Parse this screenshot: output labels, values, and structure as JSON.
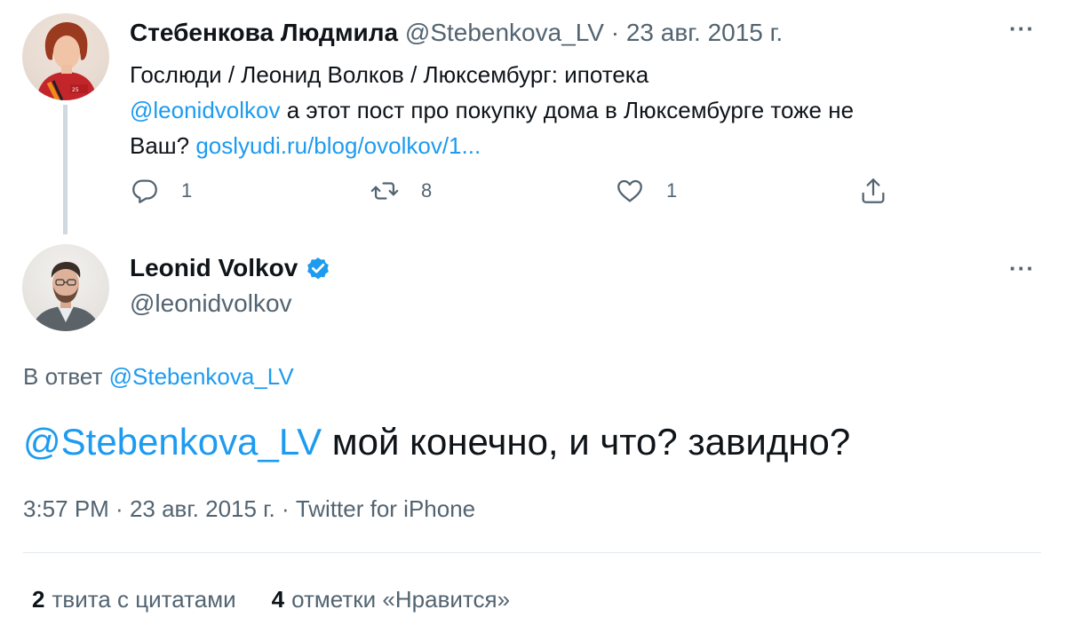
{
  "parent_tweet": {
    "author_name": "Стебенкова Людмила",
    "author_handle": "@Stebenkova_LV",
    "separator": "·",
    "date": "23 авг. 2015 г.",
    "more_label": "···",
    "line1": "Гослюди / Леонид Волков / Люксембург: ипотека",
    "mention": "@leonidvolkov",
    "line2_text": " а этот пост про покупку дома в Люксембурге тоже не",
    "line3_text": "Ваш? ",
    "url": "goslyudi.ru/blog/ovolkov/1...",
    "reply_count": "1",
    "retweet_count": "8",
    "like_count": "1"
  },
  "main_tweet": {
    "author_name": "Leonid Volkov",
    "author_handle": "@leonidvolkov",
    "more_label": "···",
    "reply_prefix": "В ответ ",
    "reply_to": "@Stebenkova_LV",
    "text_mention": "@Stebenkova_LV",
    "text": " мой конечно, и что? завидно?",
    "time": "3:57 PM",
    "meta_sep1": " · ",
    "date": "23 авг. 2015 г.",
    "meta_sep2": " · ",
    "source": "Twitter for iPhone",
    "quote_count": "2",
    "quote_label": "твита с цитатами",
    "like_count": "4",
    "like_label": "отметки «Нравится»"
  },
  "icons": {
    "reply": "reply-icon",
    "retweet": "retweet-icon",
    "like": "heart-icon",
    "share": "share-icon",
    "verified": "verified-badge-icon"
  },
  "colors": {
    "link": "#1d9bf0",
    "muted": "#536471",
    "text": "#0f1419",
    "verified": "#1d9bf0"
  }
}
